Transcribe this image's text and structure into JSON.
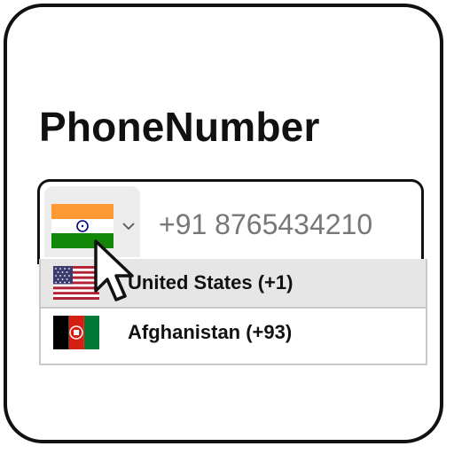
{
  "title": "PhoneNumber",
  "phone": {
    "country_flag_icon": "india-flag-icon",
    "value": "+91 8765434210"
  },
  "dropdown": {
    "options": [
      {
        "label": "United States (+1)",
        "flag_icon": "usa-flag-icon",
        "highlighted": true
      },
      {
        "label": "Afghanistan (+93)",
        "flag_icon": "afghanistan-flag-icon",
        "highlighted": false
      }
    ]
  },
  "colors": {
    "frame_border": "#111111",
    "country_select_bg": "#ececec",
    "highlight_bg": "#e6e6e6",
    "input_text": "#777777",
    "dropdown_border": "#c9c9c9"
  }
}
